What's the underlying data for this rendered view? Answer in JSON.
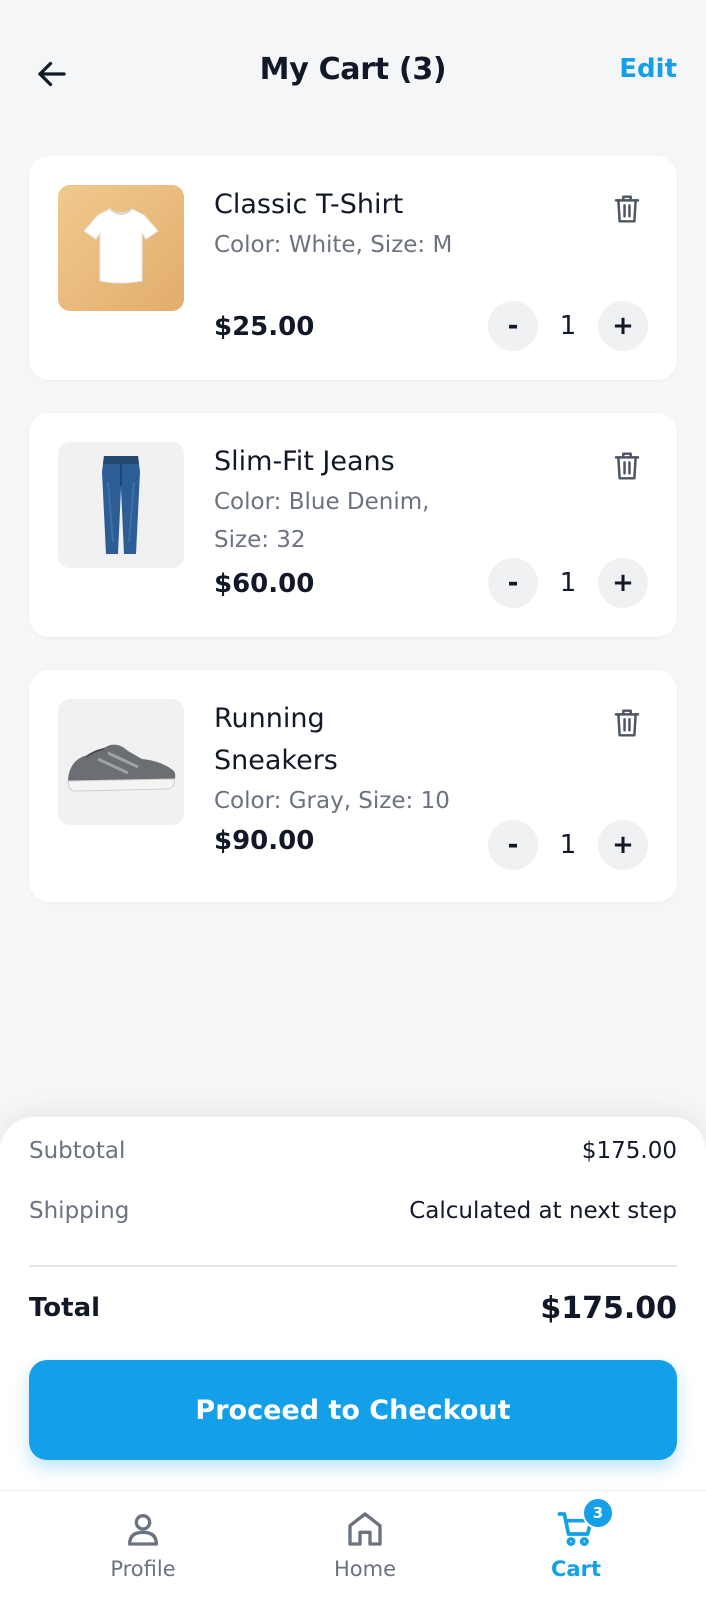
{
  "header": {
    "title": "My Cart (3)",
    "edit_label": "Edit",
    "back_icon": "arrow-left-icon"
  },
  "items": [
    {
      "name": "Classic T-Shirt",
      "variant": "Color: White, Size: M",
      "price": "$25.00",
      "quantity": "1",
      "image": "white-t-shirt"
    },
    {
      "name": "Slim-Fit Jeans",
      "variant": "Color: Blue Denim, Size: 32",
      "price": "$60.00",
      "quantity": "1",
      "image": "blue-jeans"
    },
    {
      "name": "Running Sneakers",
      "variant": "Color: Gray, Size: 10",
      "price": "$90.00",
      "quantity": "1",
      "image": "gray-sneaker"
    }
  ],
  "qty_controls": {
    "minus": "-",
    "plus": "+"
  },
  "summary": {
    "subtotal_label": "Subtotal",
    "subtotal_value": "$175.00",
    "shipping_label": "Shipping",
    "shipping_value": "Calculated at next step",
    "total_label": "Total",
    "total_value": "$175.00",
    "checkout_label": "Proceed to Checkout"
  },
  "nav": {
    "items": [
      {
        "label": "Profile",
        "icon": "user-icon",
        "active": false
      },
      {
        "label": "Home",
        "icon": "home-icon",
        "active": false
      },
      {
        "label": "Cart",
        "icon": "cart-icon",
        "active": true,
        "badge": "3"
      }
    ]
  },
  "colors": {
    "accent": "#14a0e8",
    "background": "#f5f6f8",
    "card": "#ffffff",
    "text_primary": "#111827",
    "text_secondary": "#6b7280"
  }
}
